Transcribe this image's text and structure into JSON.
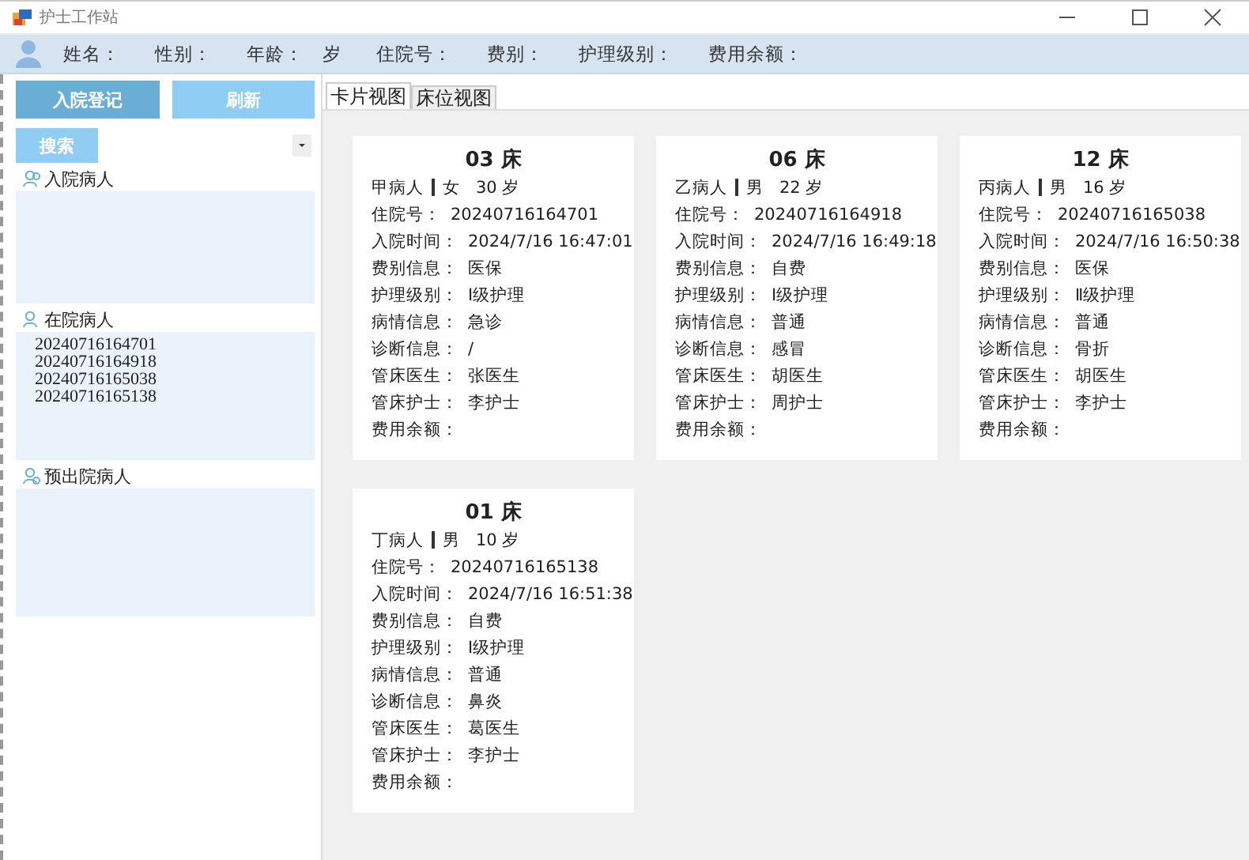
{
  "window": {
    "title": "护士工作站"
  },
  "info_bar": [
    {
      "label": "姓名："
    },
    {
      "label": "性别："
    },
    {
      "label": "年龄：",
      "unit": "岁"
    },
    {
      "label": "住院号："
    },
    {
      "label": "费别："
    },
    {
      "label": "护理级别："
    },
    {
      "label": "费用余额："
    }
  ],
  "sidebar": {
    "buttons": [
      {
        "label": "入院登记",
        "kind": "primary"
      },
      {
        "label": "刷新",
        "kind": "secondary"
      }
    ],
    "search_button": "搜索",
    "sections": [
      {
        "title": "入院病人"
      },
      {
        "title": "在院病人",
        "items": [
          "20240716164701",
          "20240716164918",
          "20240716165038",
          "20240716165138"
        ]
      },
      {
        "title": "预出院病人"
      }
    ]
  },
  "tabs": [
    {
      "label": "卡片视图",
      "selected": true
    },
    {
      "label": "床位视图",
      "selected": false
    }
  ],
  "cards": [
    {
      "bed": "03 床",
      "name": "甲病人",
      "gender": "女",
      "age": "30 岁",
      "fields": [
        {
          "label": "住院号：",
          "value": "20240716164701"
        },
        {
          "label": "入院时间：",
          "value": "2024/7/16 16:47:01"
        },
        {
          "label": "费别信息：",
          "value": "医保"
        },
        {
          "label": "护理级别：",
          "value": "Ⅰ级护理"
        },
        {
          "label": "病情信息：",
          "value": "急诊"
        },
        {
          "label": "诊断信息：",
          "value": "/"
        },
        {
          "label": "管床医生：",
          "value": "张医生"
        },
        {
          "label": "管床护士：",
          "value": "李护士"
        },
        {
          "label": "费用余额："
        }
      ]
    },
    {
      "bed": "06 床",
      "name": "乙病人",
      "gender": "男",
      "age": "22 岁",
      "fields": [
        {
          "label": "住院号：",
          "value": "20240716164918"
        },
        {
          "label": "入院时间：",
          "value": "2024/7/16 16:49:18"
        },
        {
          "label": "费别信息：",
          "value": "自费"
        },
        {
          "label": "护理级别：",
          "value": "Ⅰ级护理"
        },
        {
          "label": "病情信息：",
          "value": "普通"
        },
        {
          "label": "诊断信息：",
          "value": "感冒"
        },
        {
          "label": "管床医生：",
          "value": "胡医生"
        },
        {
          "label": "管床护士：",
          "value": "周护士"
        },
        {
          "label": "费用余额："
        }
      ]
    },
    {
      "bed": "12 床",
      "name": "丙病人",
      "gender": "男",
      "age": "16 岁",
      "fields": [
        {
          "label": "住院号：",
          "value": "20240716165038"
        },
        {
          "label": "入院时间：",
          "value": "2024/7/16 16:50:38"
        },
        {
          "label": "费别信息：",
          "value": "医保"
        },
        {
          "label": "护理级别：",
          "value": "Ⅱ级护理"
        },
        {
          "label": "病情信息：",
          "value": "普通"
        },
        {
          "label": "诊断信息：",
          "value": "骨折"
        },
        {
          "label": "管床医生：",
          "value": "胡医生"
        },
        {
          "label": "管床护士：",
          "value": "李护士"
        },
        {
          "label": "费用余额："
        }
      ]
    },
    {
      "bed": "01 床",
      "name": "丁病人",
      "gender": "男",
      "age": "10 岁",
      "fields": [
        {
          "label": "住院号：",
          "value": "20240716165138"
        },
        {
          "label": "入院时间：",
          "value": "2024/7/16 16:51:38"
        },
        {
          "label": "费别信息：",
          "value": "自费"
        },
        {
          "label": "护理级别：",
          "value": "Ⅰ级护理"
        },
        {
          "label": "病情信息：",
          "value": "普通"
        },
        {
          "label": "诊断信息：",
          "value": "鼻炎"
        },
        {
          "label": "管床医生：",
          "value": "葛医生"
        },
        {
          "label": "管床护士：",
          "value": "李护士"
        },
        {
          "label": "费用余额："
        }
      ]
    }
  ]
}
